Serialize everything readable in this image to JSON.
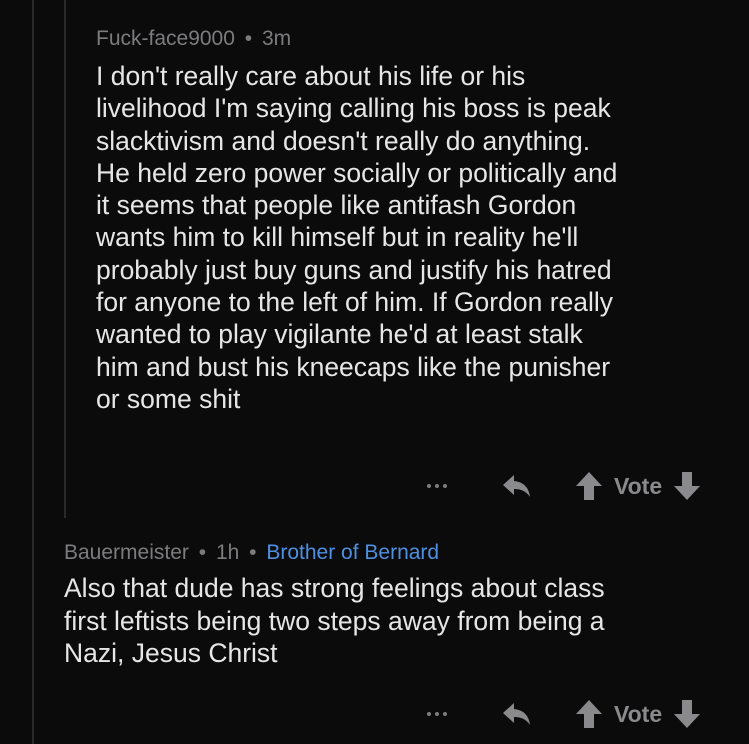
{
  "comments": [
    {
      "author": "Fuck-face9000",
      "separator": "•",
      "time": "3m",
      "lines": [
        "I don't really care about his life or his",
        "livelihood I'm saying calling his boss is peak",
        "slacktivism and doesn't really do anything.",
        "He held zero power socially or politically and",
        "it seems that people like antifash Gordon",
        "wants him to kill himself but in reality he'll",
        "probably just buy guns and justify his hatred",
        "for anyone to the left of him. If Gordon really",
        "wanted to play vigilante he'd at least stalk",
        "him and bust his kneecaps like the punisher",
        "or some shit"
      ],
      "vote_label": "Vote"
    },
    {
      "author": "Bauermeister",
      "separator": "•",
      "time": "1h",
      "separator2": "•",
      "flair": "Brother of Bernard",
      "lines": [
        "Also that dude has strong feelings about class",
        "first leftists being two steps away from being a",
        "Nazi, Jesus Christ"
      ],
      "vote_label": "Vote"
    }
  ],
  "icons": {
    "more": "more-options-icon",
    "reply": "reply-arrow-icon",
    "upvote": "upvote-arrow-icon",
    "downvote": "downvote-arrow-icon"
  },
  "colors": {
    "background": "#0b0b0c",
    "text": "#e6e6e7",
    "meta": "#7c7c7f",
    "flair": "#4f8fe0"
  }
}
